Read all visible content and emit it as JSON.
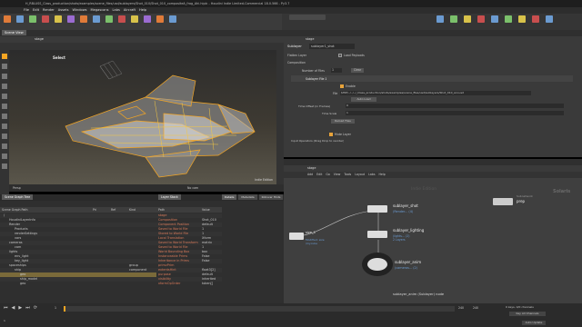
{
  "window": {
    "title": "H_RBLUSS_Class_production/shots/examples/scene_files/usd/sublayers/Shot_010/Shot_010_compositeA_frog_Ahi.hiplc - Houdini Indie Limited-Commercial 18.0.566 - Py3.7"
  },
  "menubar": [
    "File",
    "Edit",
    "Render",
    "Assets",
    "Windows",
    "Megascans",
    "Labs",
    "Aircraft",
    "Help"
  ],
  "viewport": {
    "tab": "Scene View",
    "path": "stage",
    "mode_label": "Select",
    "status_left": "Persp",
    "status_cam": "No cam",
    "status_render": "Indie Edition",
    "timeline_frame": "240",
    "timeline_end": "240"
  },
  "parameter_panel": {
    "node_type": "Sublayer",
    "node_name": "sublayer1_shot",
    "section_flatten": "Flatten Layer",
    "flatten_label": "Load Payloads",
    "section_composition": "Composition",
    "num_files_label": "Number of Files",
    "num_files_value": "1",
    "clear_label": "Clear",
    "file_block": "Sublayer File 1",
    "enable_label": "Enable",
    "file_label": "File",
    "file_value": "$HIP/../../../_Class_production/shots/examples/scene_files/usd/sublayers/Shot_010_ani.usd",
    "auto_load_label": "Auto Load",
    "time_offset_label": "Time Offset (in Frames)",
    "time_offset_value": "0",
    "time_scale_label": "Time Scale",
    "time_scale_value": "1",
    "reload_label": "Reload Files",
    "mute_label": "Mute Layer",
    "input_ops_label": "Input Operators (Drag Drop to reorder)"
  },
  "scene_graph": {
    "tab": "Scene Graph Tree",
    "columns": [
      "Scene Graph Path",
      "Pri",
      "Ref",
      "Kind"
    ],
    "rows": [
      {
        "name": "/",
        "kind": "",
        "indent": 0
      },
      {
        "name": "HoudiniLayerInfo",
        "kind": "",
        "indent": 1
      },
      {
        "name": "Render",
        "kind": "",
        "indent": 1
      },
      {
        "name": "Products",
        "kind": "",
        "indent": 2
      },
      {
        "name": "renderSettings",
        "kind": "",
        "indent": 2
      },
      {
        "name": "vars",
        "kind": "",
        "indent": 2
      },
      {
        "name": "cameras",
        "kind": "",
        "indent": 1
      },
      {
        "name": "cam",
        "kind": "",
        "indent": 2
      },
      {
        "name": "lights",
        "kind": "",
        "indent": 1
      },
      {
        "name": "env_light",
        "kind": "",
        "indent": 2
      },
      {
        "name": "key_light",
        "kind": "",
        "indent": 2
      },
      {
        "name": "spaceships",
        "kind": "group",
        "indent": 1
      },
      {
        "name": "ship",
        "kind": "component",
        "indent": 2
      },
      {
        "name": "geo",
        "kind": "",
        "indent": 3
      },
      {
        "name": "ship_model",
        "kind": "",
        "indent": 3
      },
      {
        "name": "geo",
        "kind": "",
        "indent": 3
      }
    ]
  },
  "layer_stack": {
    "tab": "Layer Stack",
    "columns": [
      "Path",
      "Value"
    ],
    "rows": [
      {
        "name": "stage",
        "value": ""
      },
      {
        "name": "Composition",
        "value": "Shot_010"
      },
      {
        "name": "Component Position",
        "value": "default"
      },
      {
        "name": "Saved to World File",
        "value": "1"
      },
      {
        "name": "Stored to World File",
        "value": "1"
      },
      {
        "name": "Local Translation",
        "value": "Xform"
      },
      {
        "name": "Saved to World Transform",
        "value": "matrix"
      },
      {
        "name": "Saved to World File",
        "value": "1"
      },
      {
        "name": "World Bounding Box",
        "value": "box"
      },
      {
        "name": "Instanceable Prims",
        "value": "False"
      },
      {
        "name": "Inheritance in Prims",
        "value": "False"
      },
      {
        "name": "primvPrim",
        "value": ""
      },
      {
        "name": "extentsHint",
        "value": "float3[2]"
      },
      {
        "name": "purpose",
        "value": "default"
      },
      {
        "name": "visibility",
        "value": "inherited"
      },
      {
        "name": "xformOpOrder",
        "value": "token[]"
      }
    ]
  },
  "mid_tabs": [
    "Details",
    "Metadata",
    "Rollover Hints"
  ],
  "network": {
    "path": "stage",
    "menu": [
      "Add",
      "Edit",
      "Go",
      "View",
      "Tools",
      "Layout",
      "Labs",
      "Help"
    ],
    "watermark": "Indie Edition",
    "brand": "Solaris",
    "nodes": [
      {
        "id": "sublayer_shot",
        "label": "sublayer_shot",
        "sub": "(Render... (4)",
        "color": "#6b9bd1"
      },
      {
        "id": "sublayer_lighting",
        "label": "sublayer_lighting",
        "sub": "(lights... (2)\n2 Layers",
        "color": "#6b9bd1"
      },
      {
        "id": "sublayer_anim",
        "label": "sublayer_anim",
        "sub": "(cameras... (2)",
        "color": "#6b9bd1"
      },
      {
        "id": "size_1",
        "label": "size_1",
        "sub": "Modified: size\n/mycube",
        "color": "#6b9bd1"
      },
      {
        "id": "prep",
        "label": "prep",
        "sub": "Subnetwork",
        "color": "#c8c8c8"
      }
    ],
    "status": "sublayer_anim (Sublayer) node"
  },
  "playbar": {
    "frame": "1",
    "start": "1",
    "end": "240",
    "end2": "240",
    "keys_label": "0 keys, 0/0 channels",
    "key_all": "Key All Channels",
    "auto_update": "Auto Update"
  },
  "colors": {
    "accent": "#f5a623",
    "panel": "#3a3a3a",
    "dark": "#2b2b2b",
    "wire": "#d4a017"
  }
}
